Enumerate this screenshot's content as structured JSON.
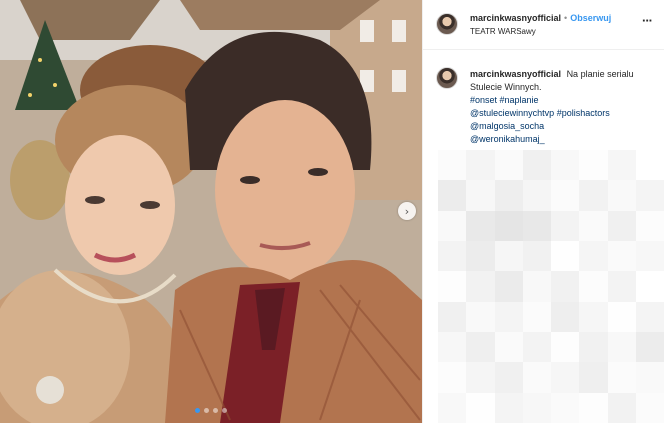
{
  "post": {
    "username": "marcinkwasnyofficial",
    "separator": "•",
    "follow_label": "Obserwuj",
    "location": "TEATR WARSawy",
    "more_icon": "ellipsis-icon",
    "caption": {
      "username": "marcinkwasnyofficial",
      "text": "Na planie serialu Stulecie Winnych.",
      "hashtags_line": "#onset #naplanie",
      "tag_line_2_a": "@stuleciewinnychtvp",
      "tag_line_2_b": "#polishactors",
      "mention_1": "@malgosia_socha",
      "mention_2": "@weronikahumaj_"
    },
    "carousel": {
      "next_icon": "chevron-right-icon",
      "next_glyph": "›",
      "dots_count": 4,
      "active_dot": 1
    }
  }
}
